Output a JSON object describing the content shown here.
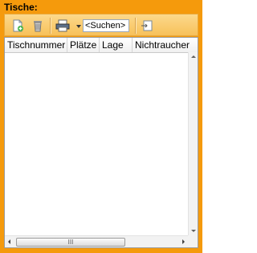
{
  "panel": {
    "title": "Tische:"
  },
  "toolbar": {
    "new_icon": "new-document-icon",
    "delete_icon": "trash-icon",
    "print_icon": "printer-icon",
    "print_menu_icon": "dropdown-arrow-icon",
    "search_value": "<Suchen>",
    "export_icon": "export-icon"
  },
  "grid": {
    "columns": [
      "Tischnummer",
      "Plätze",
      "Lage",
      "Nichtraucher"
    ],
    "rows": []
  },
  "scrollbar": {
    "thumb_grip": "III"
  },
  "colors": {
    "panel_bg": "#f59a0c",
    "toolbar_bg": "#f7c15a"
  }
}
